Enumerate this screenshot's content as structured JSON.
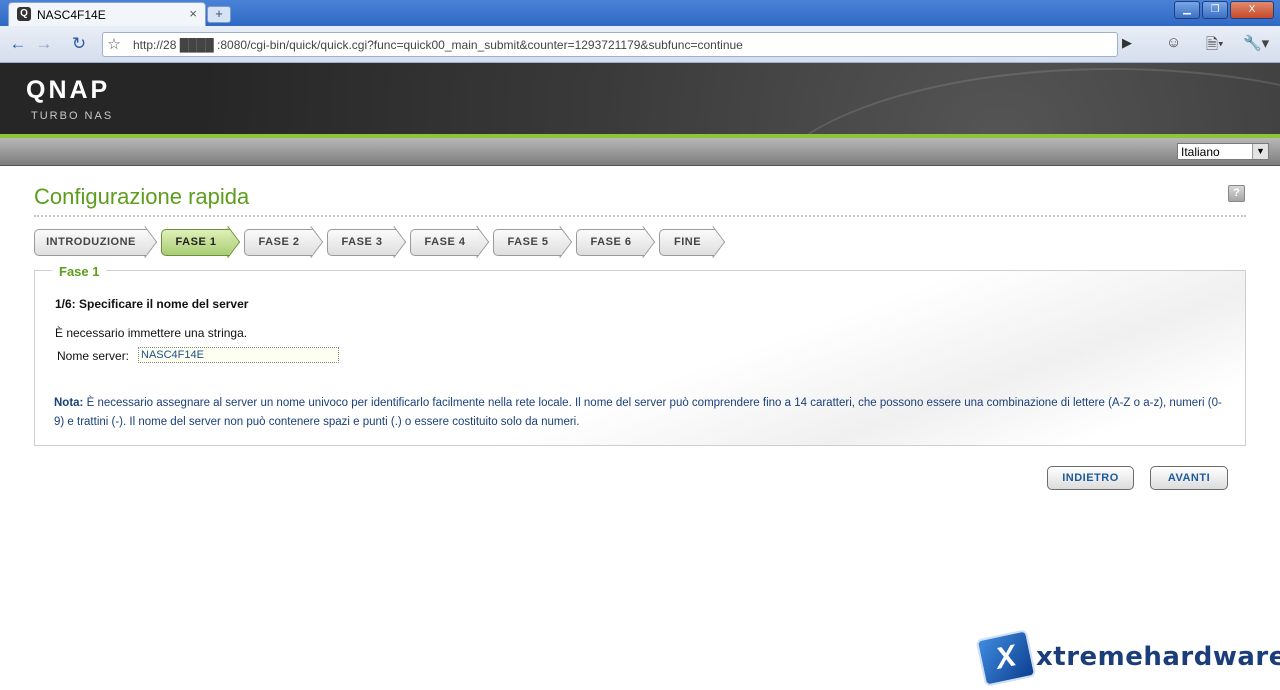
{
  "browser": {
    "tab_title": "NASC4F14E",
    "tab_close": "×",
    "new_tab": "+",
    "url": "http://28 ████ :8080/cgi-bin/quick/quick.cgi?func=quick00_main_submit&counter=1293721179&subfunc=continue",
    "win_min": "▁",
    "win_max": "❐",
    "win_close": "X"
  },
  "header": {
    "logo": "QNAP",
    "logo_sub": "TURBO NAS"
  },
  "language": {
    "selected": "Italiano"
  },
  "page": {
    "title": "Configurazione rapida",
    "help": "?"
  },
  "steps": [
    {
      "label": "INTRODUZIONE",
      "active": false
    },
    {
      "label": "FASE 1",
      "active": true
    },
    {
      "label": "FASE 2",
      "active": false
    },
    {
      "label": "FASE 3",
      "active": false
    },
    {
      "label": "FASE 4",
      "active": false
    },
    {
      "label": "FASE 5",
      "active": false
    },
    {
      "label": "FASE 6",
      "active": false
    },
    {
      "label": "FINE",
      "active": false
    }
  ],
  "form": {
    "legend": "Fase 1",
    "heading": "1/6: Specificare il nome del server",
    "required_text": "È necessario immettere una stringa.",
    "server_label": "Nome server:",
    "server_value": "NASC4F14E",
    "note_label": "Nota:",
    "note_text": " È necessario assegnare al server un nome univoco per identificarlo facilmente nella rete locale. Il nome del server può comprendere fino a 14 caratteri, che possono essere una combinazione di lettere (A-Z o a-z), numeri (0-9) e trattini (-). Il nome del server non può contenere spazi e punti (.) o essere costituito solo da numeri."
  },
  "buttons": {
    "back": "INDIETRO",
    "next": "AVANTI"
  },
  "watermark": {
    "text": "xtremehardware.it"
  }
}
